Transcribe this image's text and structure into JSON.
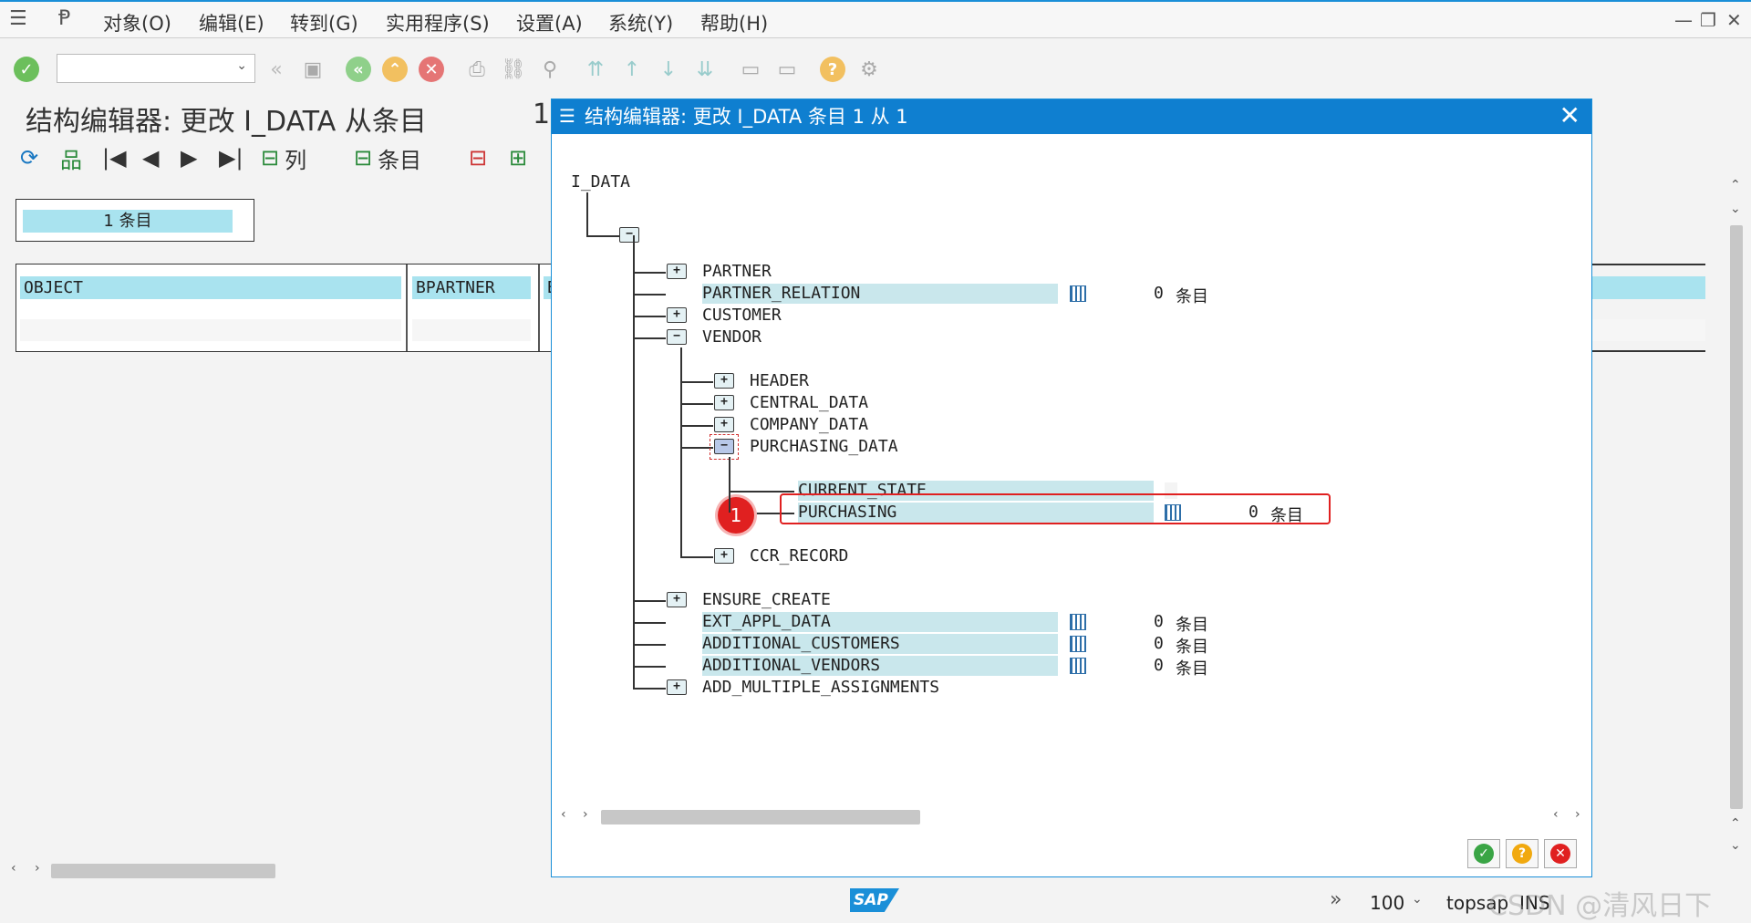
{
  "menubar": {
    "items": [
      "对象(O)",
      "编辑(E)",
      "转到(G)",
      "实用程序(S)",
      "设置(A)",
      "系统(Y)",
      "帮助(H)"
    ]
  },
  "page": {
    "title": "结构编辑器: 更改 I_DATA 从条目",
    "title_suffix": "1"
  },
  "toolbar2": {
    "col_label": "列",
    "entry_label": "条目"
  },
  "background_table": {
    "count_label": "1 条目",
    "headers": [
      "OBJECT",
      "BPARTNER",
      "B"
    ]
  },
  "dialog": {
    "title": "结构编辑器: 更改 I_DATA 条目 1 从 1",
    "root": "I_DATA",
    "level1": [
      {
        "name": "PARTNER",
        "kind": "folder"
      },
      {
        "name": "PARTNER_RELATION",
        "kind": "table",
        "count": "0",
        "unit": "条目"
      },
      {
        "name": "CUSTOMER",
        "kind": "folder"
      },
      {
        "name": "VENDOR",
        "kind": "folder-open"
      }
    ],
    "vendor_children": [
      {
        "name": "HEADER",
        "kind": "folder"
      },
      {
        "name": "CENTRAL_DATA",
        "kind": "folder"
      },
      {
        "name": "COMPANY_DATA",
        "kind": "folder"
      },
      {
        "name": "PURCHASING_DATA",
        "kind": "folder-open"
      },
      {
        "name": "CCR_RECORD",
        "kind": "folder"
      }
    ],
    "purchasing_children": [
      {
        "name": "CURRENT_STATE",
        "kind": "field"
      },
      {
        "name": "PURCHASING",
        "kind": "table",
        "count": "0",
        "unit": "条目"
      }
    ],
    "level1_after": [
      {
        "name": "ENSURE_CREATE",
        "kind": "folder"
      },
      {
        "name": "EXT_APPL_DATA",
        "kind": "table",
        "count": "0",
        "unit": "条目"
      },
      {
        "name": "ADDITIONAL_CUSTOMERS",
        "kind": "table",
        "count": "0",
        "unit": "条目"
      },
      {
        "name": "ADDITIONAL_VENDORS",
        "kind": "table",
        "count": "0",
        "unit": "条目"
      },
      {
        "name": "ADD_MULTIPLE_ASSIGNMENTS",
        "kind": "folder"
      }
    ],
    "annotation_badge": "1"
  },
  "statusbar": {
    "zoom": "100",
    "system": "topsap",
    "mode": "INS",
    "watermark": "CSDN @清风日下"
  },
  "colors": {
    "accent": "#0f7fd0",
    "highlight": "#c9e7ec",
    "header_cell": "#a9e3ef",
    "annotation_red": "#e02020"
  }
}
